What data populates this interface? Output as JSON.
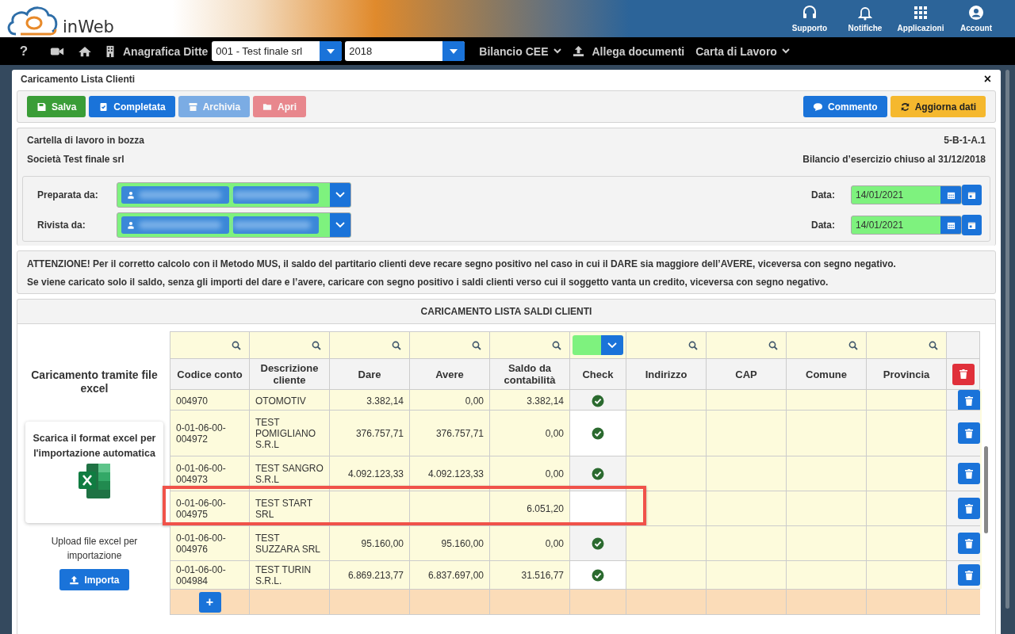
{
  "header": {
    "logo_text": "inWeb",
    "actions": [
      {
        "label": "Supporto",
        "kind": "support"
      },
      {
        "label": "Notifiche",
        "kind": "notifications"
      },
      {
        "label": "Applicazioni",
        "kind": "apps"
      },
      {
        "label": "Account",
        "kind": "account"
      }
    ]
  },
  "nav": {
    "help": "?",
    "company_label": "Anagrafica Ditte",
    "company_select": "001 - Test finale srl",
    "year_select": "2018",
    "menus": [
      {
        "label": "Bilancio CEE",
        "kind": "dropdown"
      },
      {
        "label": "Allega documenti",
        "kind": "upload"
      },
      {
        "label": "Carta di Lavoro",
        "kind": "dropdown"
      }
    ]
  },
  "dialog": {
    "title": "Caricamento Lista Clienti",
    "close": "×",
    "toolbar_left": [
      {
        "label": "Salva",
        "kind": "save",
        "disabled": false
      },
      {
        "label": "Completata",
        "kind": "complete",
        "disabled": false
      },
      {
        "label": "Archivia",
        "kind": "archive",
        "disabled": true
      },
      {
        "label": "Apri",
        "kind": "open",
        "disabled": true
      }
    ],
    "toolbar_right": [
      {
        "label": "Commento",
        "kind": "comment",
        "disabled": false
      },
      {
        "label": "Aggiorna dati",
        "kind": "refresh",
        "disabled": false
      }
    ],
    "info": {
      "status": "Cartella di lavoro in bozza",
      "code": "5-B-1-A.1",
      "company": "Società Test finale srl",
      "period": "Bilancio d’esercizio chiuso al 31/12/2018"
    },
    "signatures": [
      {
        "label": "Preparata da:",
        "date_label": "Data:",
        "date": "14/01/2021"
      },
      {
        "label": "Rivista da:",
        "date_label": "Data:",
        "date": "14/01/2021"
      }
    ],
    "notice": [
      "ATTENZIONE! Per il corretto calcolo con il Metodo MUS, il saldo del partitario clienti deve recare segno positivo nel caso in cui il DARE sia maggiore dell’AVERE, viceversa con segno negativo.",
      "Se viene caricato solo il saldo, senza gli importi del dare e l’avere, caricare con segno positivo i saldi clienti verso cui il soggetto vanta un credito, viceversa con segno negativo."
    ],
    "section_title": "CARICAMENTO LISTA SALDI CLIENTI",
    "upload": {
      "title": "Caricamento tramite file excel",
      "download": "Scarica il format excel per l'importazione automatica",
      "note": "Upload file excel per importazione",
      "button": "Importa"
    },
    "table": {
      "columns": [
        {
          "label": "Codice conto",
          "kind": "search"
        },
        {
          "label": "Descrizione cliente",
          "kind": "search"
        },
        {
          "label": "Dare",
          "kind": "search"
        },
        {
          "label": "Avere",
          "kind": "search"
        },
        {
          "label": "Saldo da contabilità",
          "kind": "search"
        },
        {
          "label": "Check",
          "kind": "select"
        },
        {
          "label": "Indirizzo",
          "kind": "search"
        },
        {
          "label": "CAP",
          "kind": "search"
        },
        {
          "label": "Comune",
          "kind": "search"
        },
        {
          "label": "Provincia",
          "kind": "search"
        }
      ],
      "rows": [
        {
          "code": "004970",
          "name": "OTOMOTIV",
          "dare": "3.382,14",
          "avere": "0,00",
          "saldo": "3.382,14",
          "checked": true,
          "highlighted": false
        },
        {
          "code": "0-01-06-00-004972",
          "name": "TEST POMIGLIANO S.R.L",
          "dare": "376.757,71",
          "avere": "376.757,71",
          "saldo": "0,00",
          "checked": true,
          "highlighted": false
        },
        {
          "code": "0-01-06-00-004973",
          "name": "TEST SANGRO S.R.L",
          "dare": "4.092.123,33",
          "avere": "4.092.123,33",
          "saldo": "0,00",
          "checked": true,
          "highlighted": false
        },
        {
          "code": "0-01-06-00-004975",
          "name": "TEST START SRL",
          "saldo": "6.051,20",
          "checked": false,
          "highlighted": true
        },
        {
          "code": "0-01-06-00-004976",
          "name": "TEST SUZZARA SRL",
          "dare": "95.160,00",
          "avere": "95.160,00",
          "saldo": "0,00",
          "checked": true,
          "highlighted": false
        },
        {
          "code": "0-01-06-00-004984",
          "name": "TEST TURIN S.R.L.",
          "dare": "6.869.213,77",
          "avere": "6.837.697,00",
          "saldo": "31.516,77",
          "checked": true,
          "highlighted": false
        }
      ],
      "add": "+"
    }
  }
}
